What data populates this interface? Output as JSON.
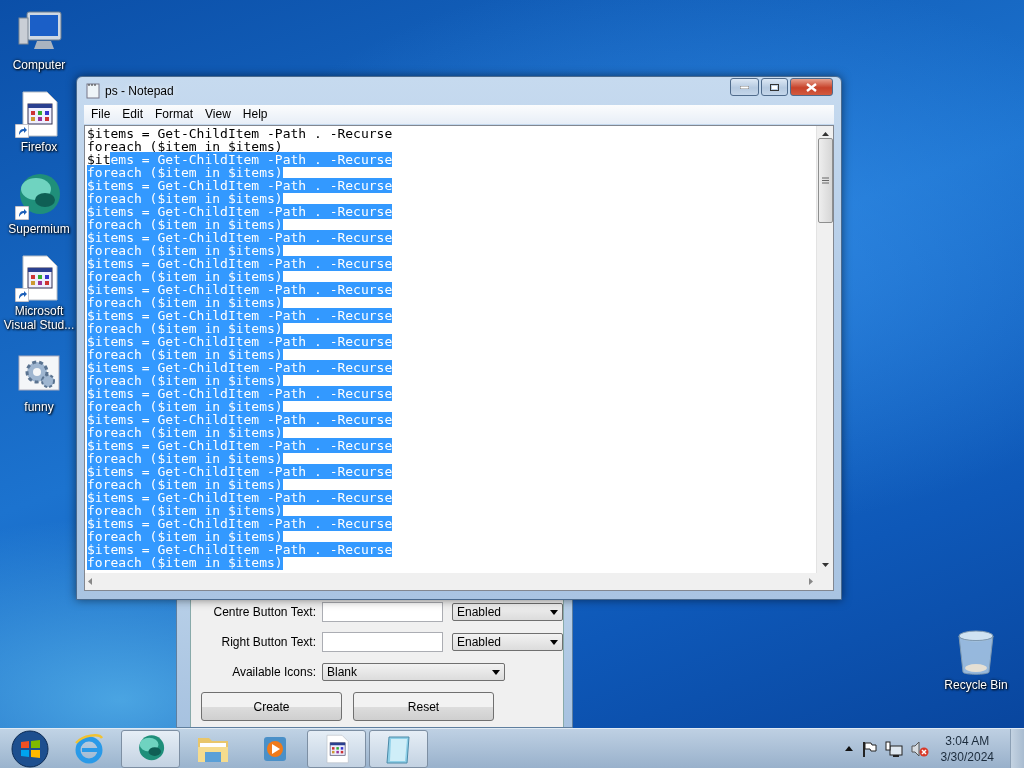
{
  "desktop_icons": [
    {
      "label": "Computer",
      "kind": "computer",
      "shortcut": false
    },
    {
      "label": "Firefox",
      "kind": "program-file",
      "shortcut": true
    },
    {
      "label": "Supermium",
      "kind": "sphere",
      "shortcut": true
    },
    {
      "label": "Microsoft Visual Stud...",
      "kind": "program-file",
      "shortcut": true
    },
    {
      "label": "funny",
      "kind": "settings-file",
      "shortcut": false
    }
  ],
  "recycle_bin": {
    "label": "Recycle Bin"
  },
  "background_dialog": {
    "rows": [
      {
        "label": "Centre Button Text:",
        "kind": "text-and-select",
        "select": "Enabled"
      },
      {
        "label": "Right Button Text:",
        "kind": "text-and-select",
        "select": "Enabled"
      },
      {
        "label": "Available Icons:",
        "kind": "select-only",
        "select": "Blank"
      }
    ],
    "buttons": [
      "Create",
      "Reset"
    ]
  },
  "notepad": {
    "title": "ps - Notepad",
    "menu": [
      "File",
      "Edit",
      "Format",
      "View",
      "Help"
    ],
    "lines": [
      {
        "parts": [
          {
            "text": "$items = Get-ChildItem -Path . -Recurse",
            "selected": false
          }
        ]
      },
      {
        "parts": [
          {
            "text": "foreach ($item in $items)",
            "selected": false
          }
        ]
      },
      {
        "parts": [
          {
            "text": "$it",
            "selected": false
          },
          {
            "text": "ems = Get-ChildItem -Path . -Recurse",
            "selected": true
          }
        ]
      },
      {
        "parts": [
          {
            "text": "foreach ($item in $items)",
            "selected": true
          }
        ]
      },
      {
        "parts": [
          {
            "text": "$items = Get-ChildItem -Path . -Recurse",
            "selected": true
          }
        ]
      },
      {
        "parts": [
          {
            "text": "foreach ($item in $items)",
            "selected": true
          }
        ]
      },
      {
        "parts": [
          {
            "text": "$items = Get-ChildItem -Path . -Recurse",
            "selected": true
          }
        ]
      },
      {
        "parts": [
          {
            "text": "foreach ($item in $items)",
            "selected": true
          }
        ]
      },
      {
        "parts": [
          {
            "text": "$items = Get-ChildItem -Path . -Recurse",
            "selected": true
          }
        ]
      },
      {
        "parts": [
          {
            "text": "foreach ($item in $items)",
            "selected": true
          }
        ]
      },
      {
        "parts": [
          {
            "text": "$items = Get-ChildItem -Path . -Recurse",
            "selected": true
          }
        ]
      },
      {
        "parts": [
          {
            "text": "foreach ($item in $items)",
            "selected": true
          }
        ]
      },
      {
        "parts": [
          {
            "text": "$items = Get-ChildItem -Path . -Recurse",
            "selected": true
          }
        ]
      },
      {
        "parts": [
          {
            "text": "foreach ($item in $items)",
            "selected": true
          }
        ]
      },
      {
        "parts": [
          {
            "text": "$items = Get-ChildItem -Path . -Recurse",
            "selected": true
          }
        ]
      },
      {
        "parts": [
          {
            "text": "foreach ($item in $items)",
            "selected": true
          }
        ]
      },
      {
        "parts": [
          {
            "text": "$items = Get-ChildItem -Path . -Recurse",
            "selected": true
          }
        ]
      },
      {
        "parts": [
          {
            "text": "foreach ($item in $items)",
            "selected": true
          }
        ]
      },
      {
        "parts": [
          {
            "text": "$items = Get-ChildItem -Path . -Recurse",
            "selected": true
          }
        ]
      },
      {
        "parts": [
          {
            "text": "foreach ($item in $items)",
            "selected": true
          }
        ]
      },
      {
        "parts": [
          {
            "text": "$items = Get-ChildItem -Path . -Recurse",
            "selected": true
          }
        ]
      },
      {
        "parts": [
          {
            "text": "foreach ($item in $items)",
            "selected": true
          }
        ]
      },
      {
        "parts": [
          {
            "text": "$items = Get-ChildItem -Path . -Recurse",
            "selected": true
          }
        ]
      },
      {
        "parts": [
          {
            "text": "foreach ($item in $items)",
            "selected": true
          }
        ]
      },
      {
        "parts": [
          {
            "text": "$items = Get-ChildItem -Path . -Recurse",
            "selected": true
          }
        ]
      },
      {
        "parts": [
          {
            "text": "foreach ($item in $items)",
            "selected": true
          }
        ]
      },
      {
        "parts": [
          {
            "text": "$items = Get-ChildItem -Path . -Recurse",
            "selected": true
          }
        ]
      },
      {
        "parts": [
          {
            "text": "foreach ($item in $items)",
            "selected": true
          }
        ]
      },
      {
        "parts": [
          {
            "text": "$items = Get-ChildItem -Path . -Recurse",
            "selected": true
          }
        ]
      },
      {
        "parts": [
          {
            "text": "foreach ($item in $items)",
            "selected": true
          }
        ]
      },
      {
        "parts": [
          {
            "text": "$items = Get-ChildItem -Path . -Recurse",
            "selected": true
          }
        ]
      },
      {
        "parts": [
          {
            "text": "foreach ($item in $items)",
            "selected": true
          }
        ]
      },
      {
        "parts": [
          {
            "text": "$items = Get-ChildItem -Path . -Recurse",
            "selected": true
          }
        ]
      },
      {
        "parts": [
          {
            "text": "foreach ($item in $items)",
            "selected": true
          }
        ]
      }
    ]
  },
  "taskbar": {
    "items": [
      {
        "kind": "browser-e",
        "active": false
      },
      {
        "kind": "sphere",
        "active": true
      },
      {
        "kind": "folder",
        "active": false
      },
      {
        "kind": "media-player",
        "active": false
      },
      {
        "kind": "program-file",
        "active": true
      },
      {
        "kind": "notepad",
        "active": true
      }
    ],
    "tray": [
      {
        "kind": "show-hidden"
      },
      {
        "kind": "flag"
      },
      {
        "kind": "network"
      },
      {
        "kind": "volume-muted"
      }
    ],
    "time": "3:04 AM",
    "date": "3/30/2024"
  }
}
